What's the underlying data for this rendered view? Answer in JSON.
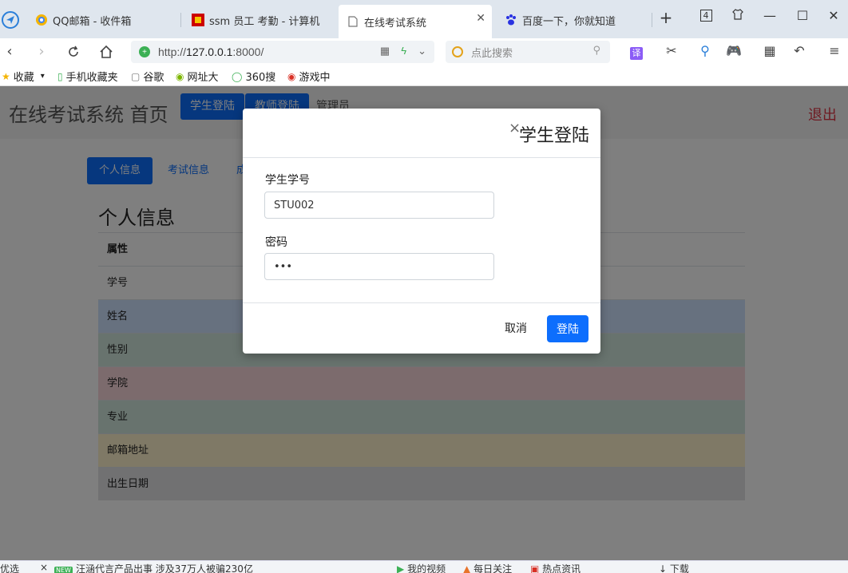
{
  "browser": {
    "tabs": [
      {
        "label": "QQ邮箱 - 收件箱",
        "icon": "qq-mail-icon"
      },
      {
        "label": "ssm 员工 考勤 - 计算机",
        "icon": "site-icon"
      },
      {
        "label": "在线考试系统",
        "icon": "page-icon",
        "active": true
      },
      {
        "label": "百度一下，你就知道",
        "icon": "baidu-icon"
      }
    ],
    "new_tab": "+",
    "tab_count": "4",
    "url_prefix": "http://",
    "url_host": "127.0.0.1",
    "url_rest": ":8000/",
    "search_placeholder": "点此搜索",
    "translate_label": "译",
    "bookmarks": [
      "收藏",
      "手机收藏夹",
      "谷歌",
      "网址大",
      "360搜",
      "游戏中"
    ]
  },
  "app": {
    "brand": "在线考试系统 首页",
    "nav": [
      "学生登陆",
      "教师登陆",
      "管理员"
    ],
    "logout": "退出",
    "pills": [
      "个人信息",
      "考试信息",
      "成"
    ],
    "section_title": "个人信息",
    "table_header": "属性",
    "rows": [
      {
        "label": "学号",
        "color": "#ffffff"
      },
      {
        "label": "姓名",
        "color": "#cfe2ff"
      },
      {
        "label": "性别",
        "color": "#d1e7dd"
      },
      {
        "label": "学院",
        "color": "#f8d7da"
      },
      {
        "label": "专业",
        "color": "#d1e7dd"
      },
      {
        "label": "邮箱地址",
        "color": "#fff3cd"
      },
      {
        "label": "出生日期",
        "color": "#e2e3e5"
      }
    ]
  },
  "modal": {
    "title": "学生登陆",
    "close": "×",
    "student_id_label": "学生学号",
    "student_id_value": "STU002",
    "password_label": "密码",
    "password_value": "•••",
    "cancel": "取消",
    "login": "登陆"
  },
  "statusbar": {
    "left": "优选",
    "news_badge": "NEW",
    "news": "汪涵代言产品出事 涉及37万人被骗230亿",
    "my_video": "我的视频",
    "daily": "每日关注",
    "hot": "热点资讯",
    "download": "下载"
  },
  "colors": {
    "primary": "#0d6efd",
    "danger": "#dc3545",
    "backdrop": "rgba(0,0,0,0.5)"
  }
}
